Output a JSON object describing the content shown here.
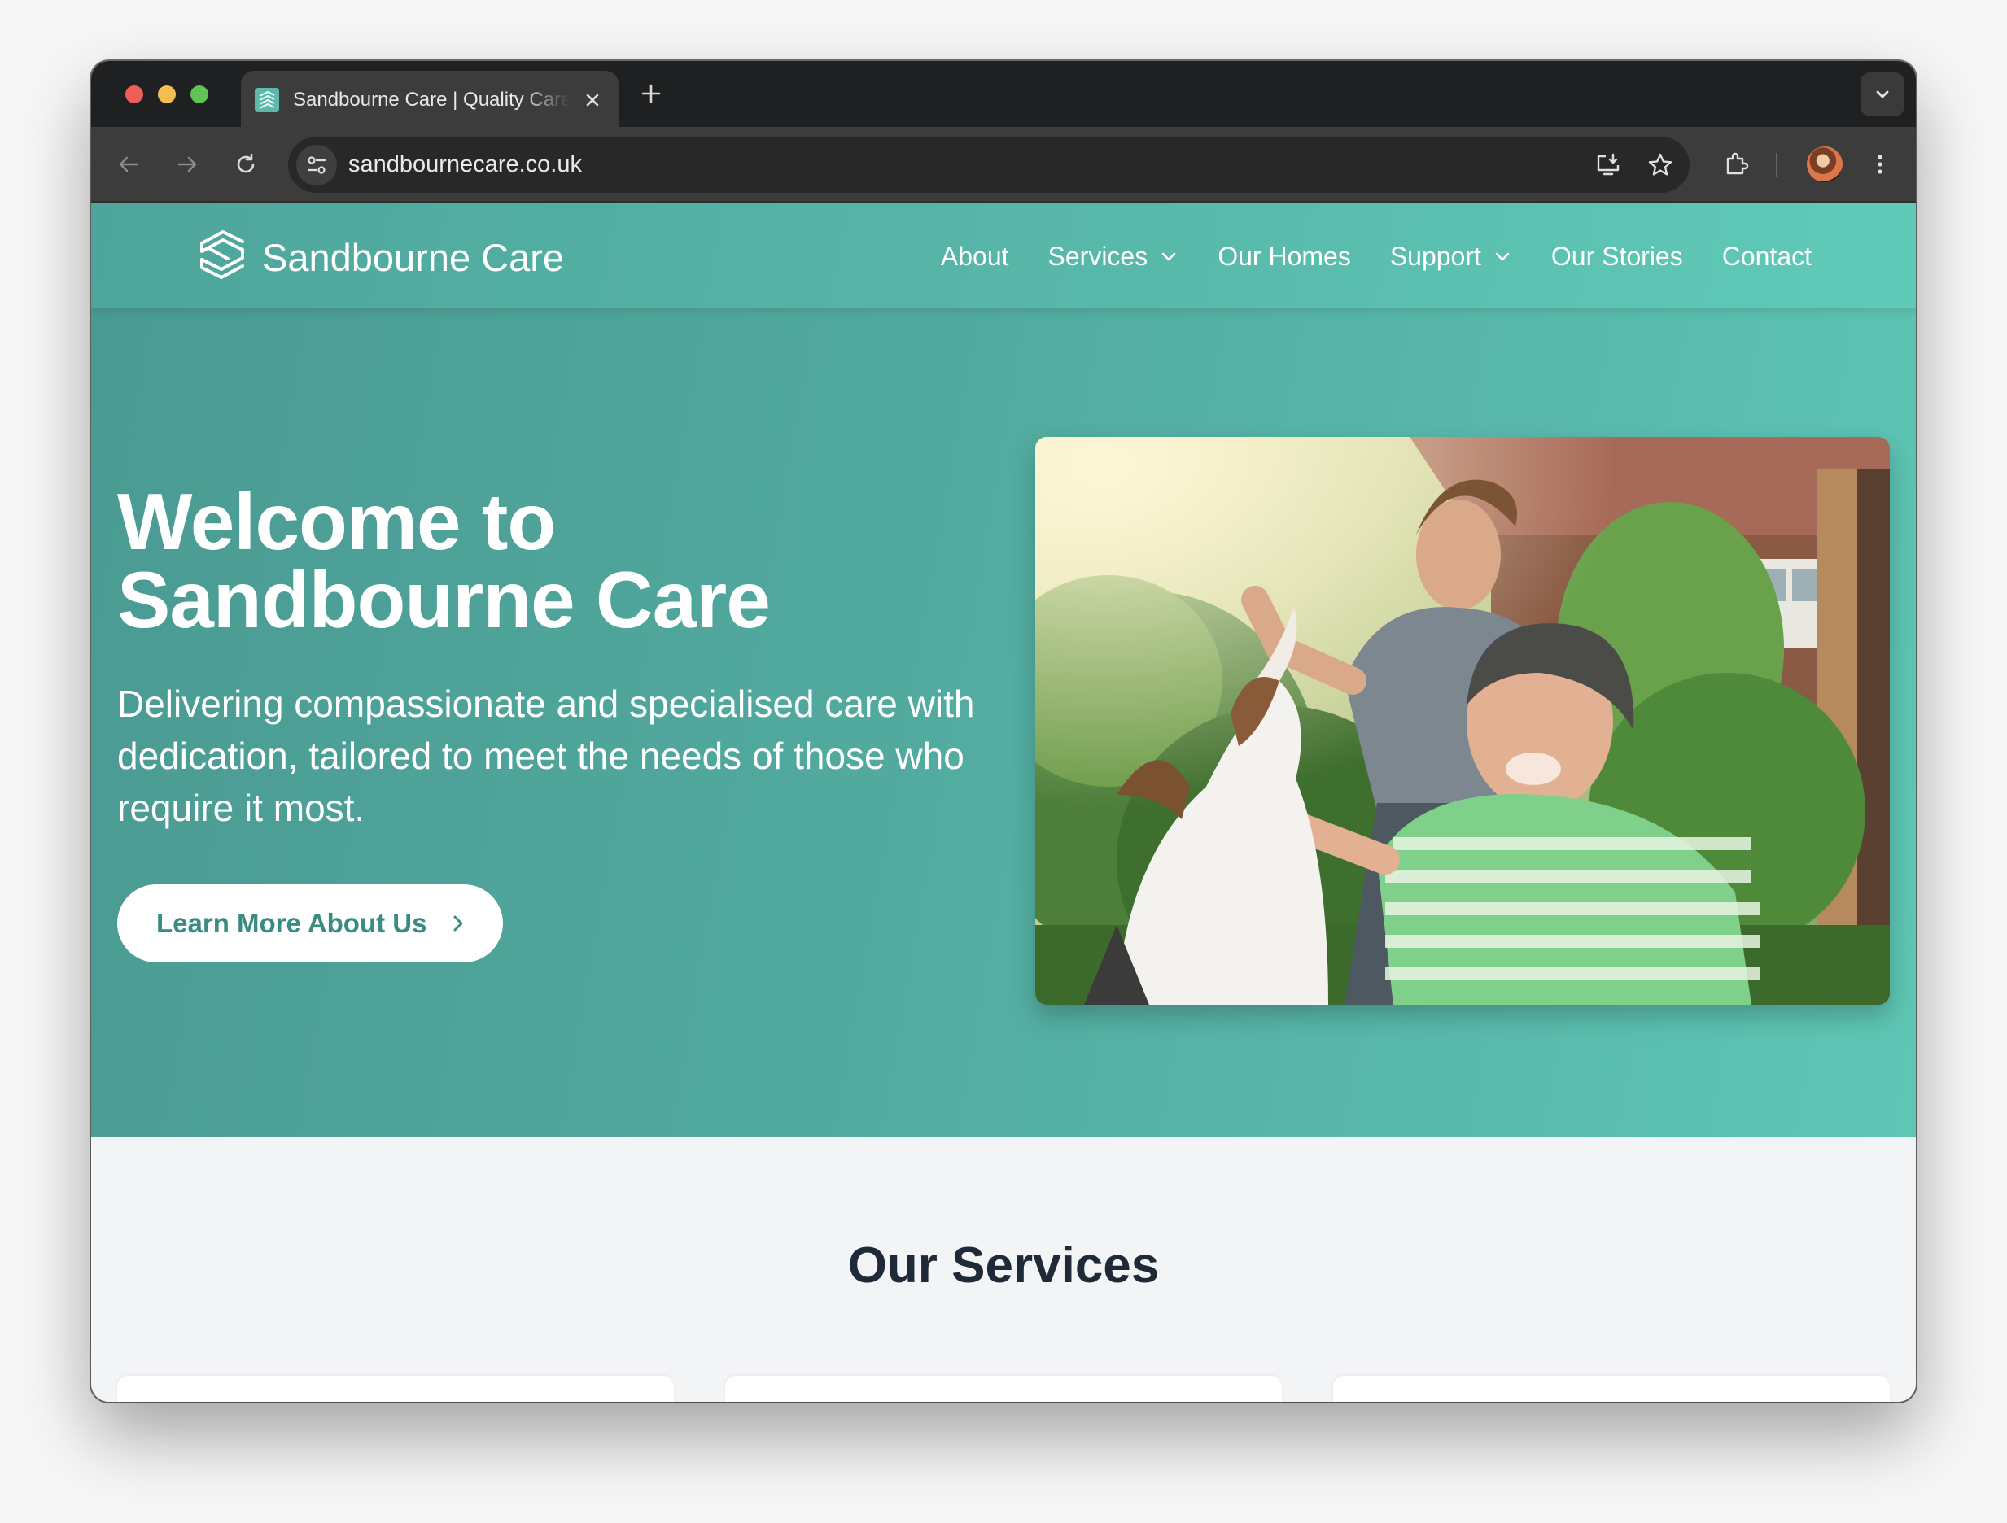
{
  "browser": {
    "tab_title": "Sandbourne Care | Quality Care",
    "url": "sandbournecare.co.uk"
  },
  "site": {
    "brand": "Sandbourne Care",
    "nav": [
      {
        "label": "About",
        "dropdown": false
      },
      {
        "label": "Services",
        "dropdown": true
      },
      {
        "label": "Our Homes",
        "dropdown": false
      },
      {
        "label": "Support",
        "dropdown": true
      },
      {
        "label": "Our Stories",
        "dropdown": false
      },
      {
        "label": "Contact",
        "dropdown": false
      }
    ]
  },
  "hero": {
    "title_line1": "Welcome to",
    "title_line2": "Sandbourne Care",
    "subtitle": "Delivering compassionate and specialised care with dedication, tailored to meet the needs of those who require it most.",
    "cta_label": "Learn More About Us"
  },
  "services": {
    "title": "Our Services"
  },
  "colors": {
    "brand_teal": "#52aa9f",
    "cta_text": "#3a8b81",
    "heading_dark": "#1f2937"
  }
}
